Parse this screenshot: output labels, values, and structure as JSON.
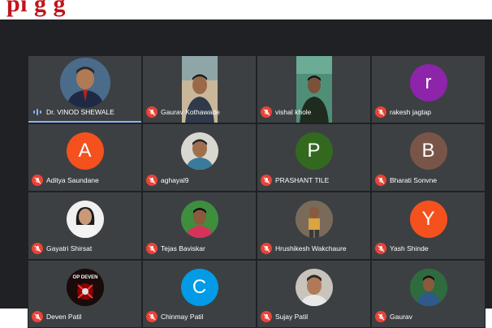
{
  "banner": {
    "text": "pi                                                              g    g"
  },
  "participants": [
    {
      "name": "Dr. VINOD SHEWALE",
      "kind": "photo",
      "mic": "speaking"
    },
    {
      "name": "Gaurav Kothawade",
      "kind": "video",
      "mic": "muted"
    },
    {
      "name": "vishal khole",
      "kind": "video",
      "mic": "muted"
    },
    {
      "name": "rakesh jagtap",
      "kind": "letter",
      "initial": "r",
      "color": "#8e24aa",
      "mic": "muted"
    },
    {
      "name": "Aditya Saundane",
      "kind": "letter",
      "initial": "A",
      "color": "#f4511e",
      "mic": "muted"
    },
    {
      "name": "aghayal9",
      "kind": "photo",
      "mic": "muted"
    },
    {
      "name": "PRASHANT TILE",
      "kind": "letter",
      "initial": "P",
      "color": "#33691e",
      "mic": "muted"
    },
    {
      "name": "Bharati Sonvne",
      "kind": "letter",
      "initial": "B",
      "color": "#795548",
      "mic": "muted"
    },
    {
      "name": "Gayatri Shirsat",
      "kind": "photo",
      "mic": "muted"
    },
    {
      "name": "Tejas Baviskar",
      "kind": "photo",
      "mic": "muted"
    },
    {
      "name": "Hrushikesh Wakchaure",
      "kind": "photo",
      "mic": "muted"
    },
    {
      "name": "Yash Shinde",
      "kind": "letter",
      "initial": "Y",
      "color": "#f4511e",
      "mic": "muted"
    },
    {
      "name": "Deven Patil",
      "kind": "logo",
      "logo_text": "OP DEVEN",
      "mic": "muted"
    },
    {
      "name": "Chinmay Patil",
      "kind": "letter",
      "initial": "C",
      "color": "#039be5",
      "mic": "muted"
    },
    {
      "name": "Sujay Patil",
      "kind": "photo",
      "mic": "muted"
    },
    {
      "name": "Gaurav",
      "kind": "photo",
      "mic": "muted"
    }
  ],
  "colors": {
    "mute": "#ea4335",
    "speaking": "#8ab4f8",
    "tile": "#3c4043",
    "background": "#202124"
  }
}
